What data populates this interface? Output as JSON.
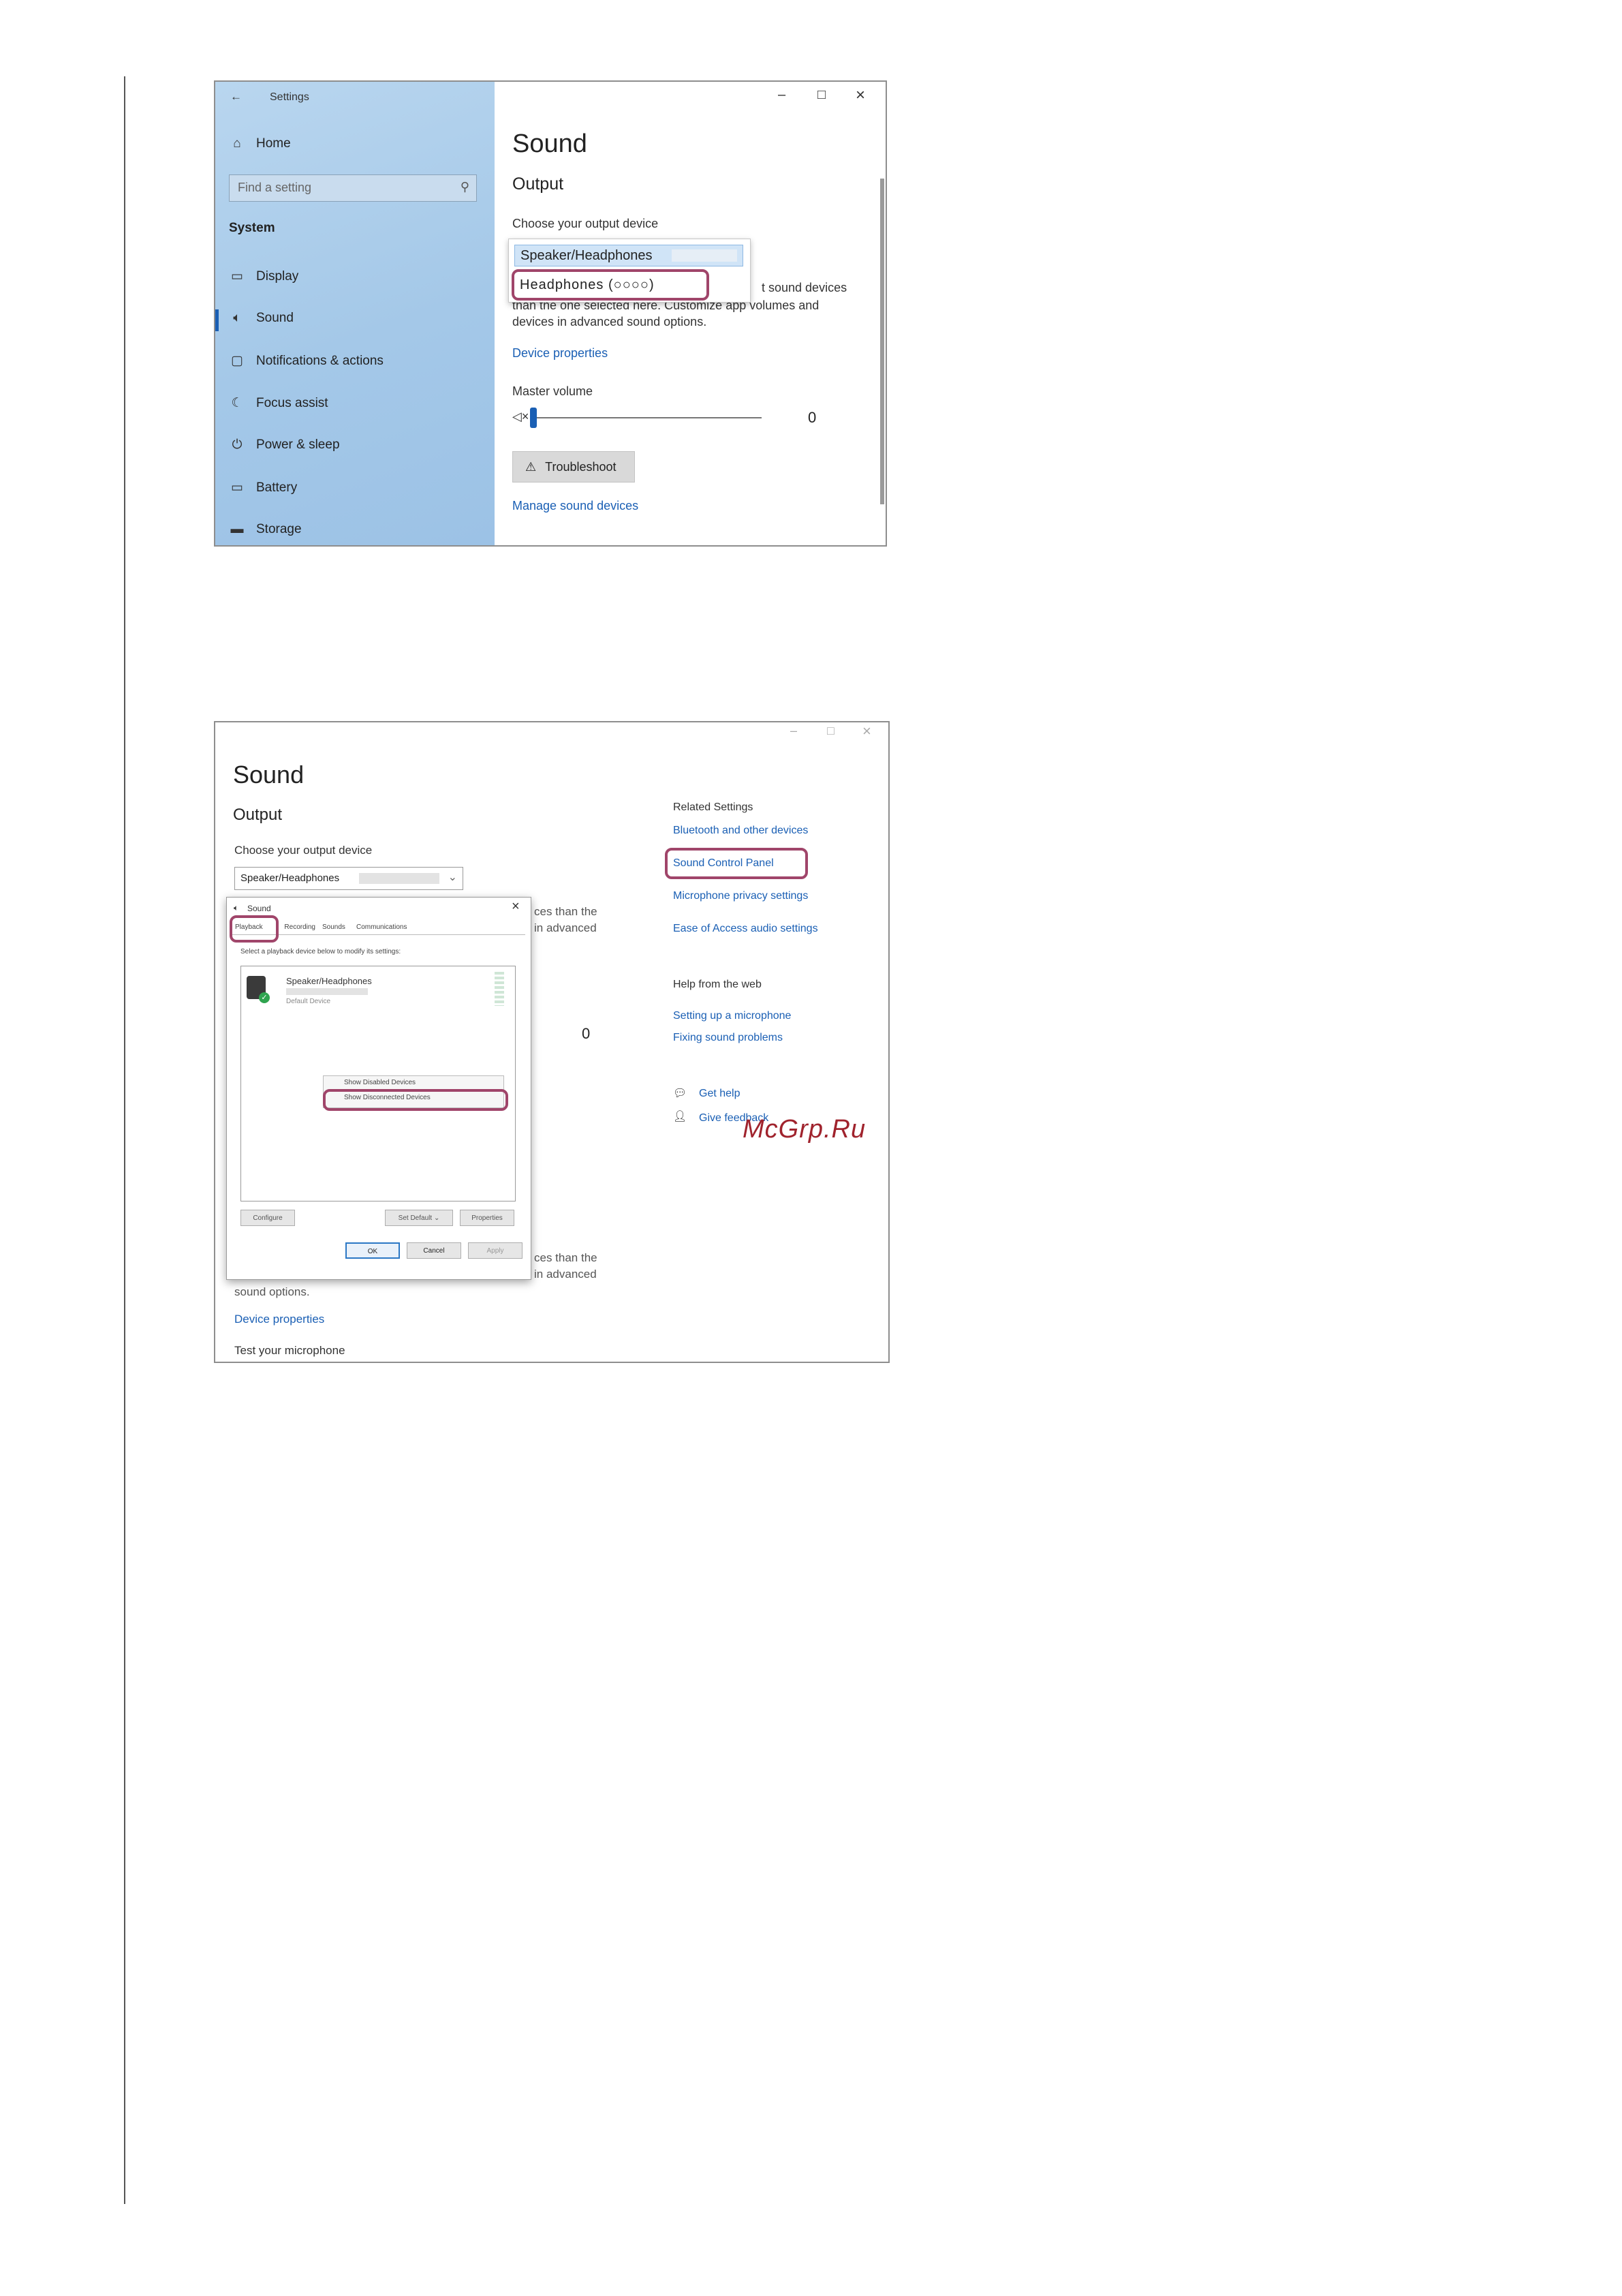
{
  "screenshot1": {
    "titlebar": {
      "back_glyph": "←",
      "title": "Settings",
      "minimize": "–",
      "maximize": "□",
      "close": "×"
    },
    "sidebar": {
      "home": "Home",
      "search_placeholder": "Find a setting",
      "section": "System",
      "items": [
        "Display",
        "Sound",
        "Notifications & actions",
        "Focus assist",
        "Power & sleep",
        "Battery",
        "Storage"
      ]
    },
    "main": {
      "title": "Sound",
      "output_heading": "Output",
      "choose_label": "Choose your output device",
      "dropdown_options": [
        "Speaker/Headphones",
        "Headphones (○○○○)"
      ],
      "desc_line1_tail": "t sound devices",
      "desc_line2": "than the one selected here. Customize app volumes and",
      "desc_line3": "devices in advanced sound options.",
      "device_properties": "Device properties",
      "master_volume": "Master volume",
      "volume_value": "0",
      "troubleshoot": "Troubleshoot",
      "manage_devices": "Manage sound devices"
    },
    "colors": {
      "accent": "#1a5fb4",
      "highlight": "#a0456a",
      "sidebar": "#a4c8e8"
    }
  },
  "screenshot2": {
    "window_controls": {
      "minimize": "–",
      "maximize": "□",
      "close": "×"
    },
    "left": {
      "title": "Sound",
      "output_heading": "Output",
      "choose_label": "Choose your output device",
      "dropdown_value": "Speaker/Headphones",
      "peek_upper1": "ces than the",
      "peek_upper2": "in advanced",
      "volume_value": "0",
      "peek_lower1": "ces than the",
      "peek_lower2": "in advanced",
      "sound_options": "sound options.",
      "device_properties": "Device properties",
      "test_mic": "Test your microphone"
    },
    "dialog": {
      "title": "Sound",
      "close": "×",
      "tabs": [
        "Playback",
        "Recording",
        "Sounds",
        "Communications"
      ],
      "instruction": "Select a playback device below to modify its settings:",
      "device_name": "Speaker/Headphones",
      "device_status": "Default Device",
      "context_menu": [
        "Show Disabled Devices",
        "Show Disconnected Devices"
      ],
      "buttons": {
        "configure": "Configure",
        "set_default": "Set Default",
        "properties": "Properties",
        "ok": "OK",
        "cancel": "Cancel",
        "apply": "Apply"
      }
    },
    "right": {
      "related_heading": "Related Settings",
      "links": [
        "Bluetooth and other devices",
        "Sound Control Panel",
        "Microphone privacy settings",
        "Ease of Access audio settings"
      ],
      "help_heading": "Help from the web",
      "help_links": [
        "Setting up a microphone",
        "Fixing sound problems"
      ],
      "get_help": "Get help",
      "give_feedback": "Give feedback"
    }
  },
  "watermark": "McGrp.Ru"
}
